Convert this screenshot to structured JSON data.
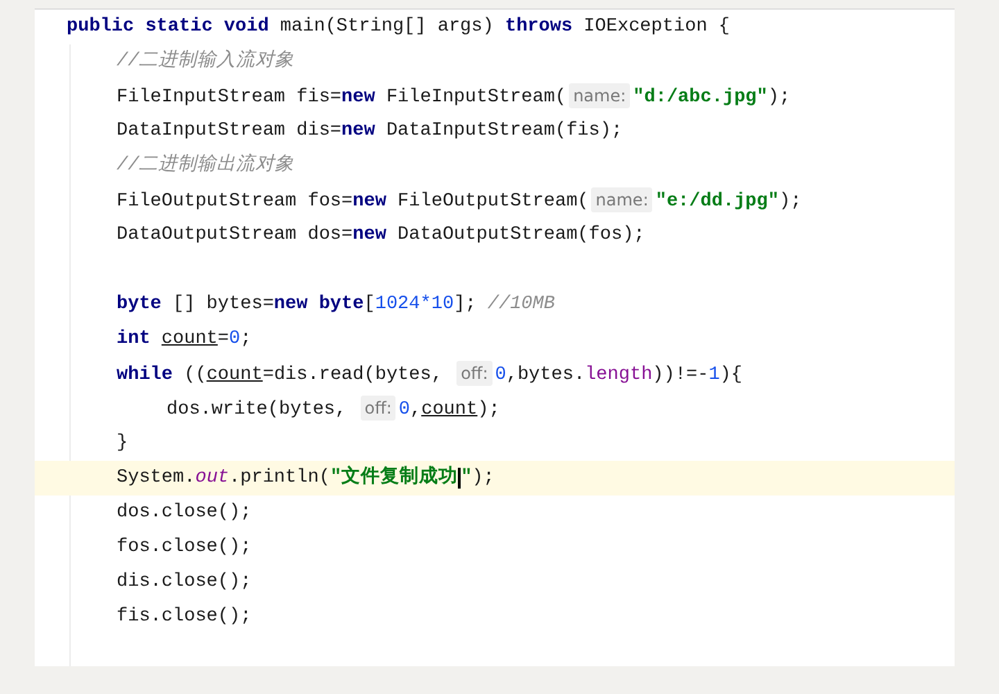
{
  "editor": {
    "lines": [
      {
        "tokens": [
          {
            "kind": "keyword",
            "text": "public static void"
          },
          {
            "kind": "plain",
            "text": " main(String[] args) "
          },
          {
            "kind": "keyword",
            "text": "throws"
          },
          {
            "kind": "plain",
            "text": " IOException {"
          }
        ],
        "current": false,
        "children": [
          {
            "tokens": [
              {
                "kind": "comment",
                "text": "//二进制输入流对象"
              }
            ],
            "current": false
          },
          {
            "tokens": [
              {
                "kind": "plain",
                "text": "FileInputStream fis="
              },
              {
                "kind": "keyword",
                "text": "new"
              },
              {
                "kind": "plain",
                "text": " FileInputStream("
              },
              {
                "kind": "hint",
                "text": "name:"
              },
              {
                "kind": "string",
                "text": "\"d:/abc.jpg\""
              },
              {
                "kind": "plain",
                "text": ");"
              }
            ],
            "current": false
          },
          {
            "tokens": [
              {
                "kind": "plain",
                "text": "DataInputStream dis="
              },
              {
                "kind": "keyword",
                "text": "new"
              },
              {
                "kind": "plain",
                "text": " DataInputStream(fis);"
              }
            ],
            "current": false
          },
          {
            "tokens": [
              {
                "kind": "comment",
                "text": "//二进制输出流对象"
              }
            ],
            "current": false
          },
          {
            "tokens": [
              {
                "kind": "plain",
                "text": "FileOutputStream fos="
              },
              {
                "kind": "keyword",
                "text": "new"
              },
              {
                "kind": "plain",
                "text": " FileOutputStream("
              },
              {
                "kind": "hint",
                "text": "name:"
              },
              {
                "kind": "string",
                "text": "\"e:/dd.jpg\""
              },
              {
                "kind": "plain",
                "text": ");"
              }
            ],
            "current": false
          },
          {
            "tokens": [
              {
                "kind": "plain",
                "text": "DataOutputStream dos="
              },
              {
                "kind": "keyword",
                "text": "new"
              },
              {
                "kind": "plain",
                "text": " DataOutputStream(fos);"
              }
            ],
            "current": false
          },
          {
            "current": false
          },
          {
            "tokens": [
              {
                "kind": "keyword",
                "text": "byte"
              },
              {
                "kind": "plain",
                "text": " [] bytes="
              },
              {
                "kind": "keyword",
                "text": "new byte"
              },
              {
                "kind": "plain",
                "text": "["
              },
              {
                "kind": "number",
                "text": "1024*10"
              },
              {
                "kind": "plain",
                "text": "]; "
              },
              {
                "kind": "comment",
                "text": "//10MB"
              }
            ],
            "current": false
          },
          {
            "tokens": [
              {
                "kind": "keyword",
                "text": "int "
              },
              {
                "kind": "variable",
                "text": "count"
              },
              {
                "kind": "plain",
                "text": "="
              },
              {
                "kind": "number",
                "text": "0"
              },
              {
                "kind": "plain",
                "text": ";"
              }
            ],
            "current": false
          },
          {
            "tokens": [
              {
                "kind": "keyword",
                "text": "while"
              },
              {
                "kind": "plain",
                "text": " (("
              },
              {
                "kind": "variable",
                "text": "count"
              },
              {
                "kind": "plain",
                "text": "=dis.read(bytes, "
              },
              {
                "kind": "hint",
                "text": "off:"
              },
              {
                "kind": "number",
                "text": "0"
              },
              {
                "kind": "plain",
                "text": ",bytes."
              },
              {
                "kind": "field",
                "text": "length"
              },
              {
                "kind": "plain",
                "text": "))!=-"
              },
              {
                "kind": "number",
                "text": "1"
              },
              {
                "kind": "plain",
                "text": "){"
              }
            ],
            "current": false,
            "children": [
              {
                "tokens": [
                  {
                    "kind": "plain",
                    "text": "dos.write(bytes, "
                  },
                  {
                    "kind": "hint",
                    "text": "off:"
                  },
                  {
                    "kind": "number",
                    "text": "0"
                  },
                  {
                    "kind": "plain",
                    "text": ","
                  },
                  {
                    "kind": "variable",
                    "text": "count"
                  },
                  {
                    "kind": "plain",
                    "text": ");"
                  }
                ],
                "current": false
              }
            ]
          },
          {
            "tokens": [
              {
                "kind": "plain",
                "text": "}"
              }
            ],
            "current": false
          },
          {
            "tokens": [
              {
                "kind": "plain",
                "text": "System."
              },
              {
                "kind": "static",
                "text": "out"
              },
              {
                "kind": "plain",
                "text": ".println("
              },
              {
                "kind": "string",
                "text": "\"文件复制成功",
                "caret": true
              },
              {
                "kind": "string",
                "text": "\""
              },
              {
                "kind": "plain",
                "text": ");"
              }
            ],
            "current": true
          },
          {
            "tokens": [
              {
                "kind": "plain",
                "text": "dos.close();"
              }
            ],
            "current": false
          },
          {
            "tokens": [
              {
                "kind": "plain",
                "text": "fos.close();"
              }
            ],
            "current": false
          },
          {
            "tokens": [
              {
                "kind": "plain",
                "text": "dis.close();"
              }
            ],
            "current": false
          },
          {
            "tokens": [
              {
                "kind": "plain",
                "text": "fis.close();"
              }
            ],
            "current": false
          }
        ]
      }
    ]
  }
}
